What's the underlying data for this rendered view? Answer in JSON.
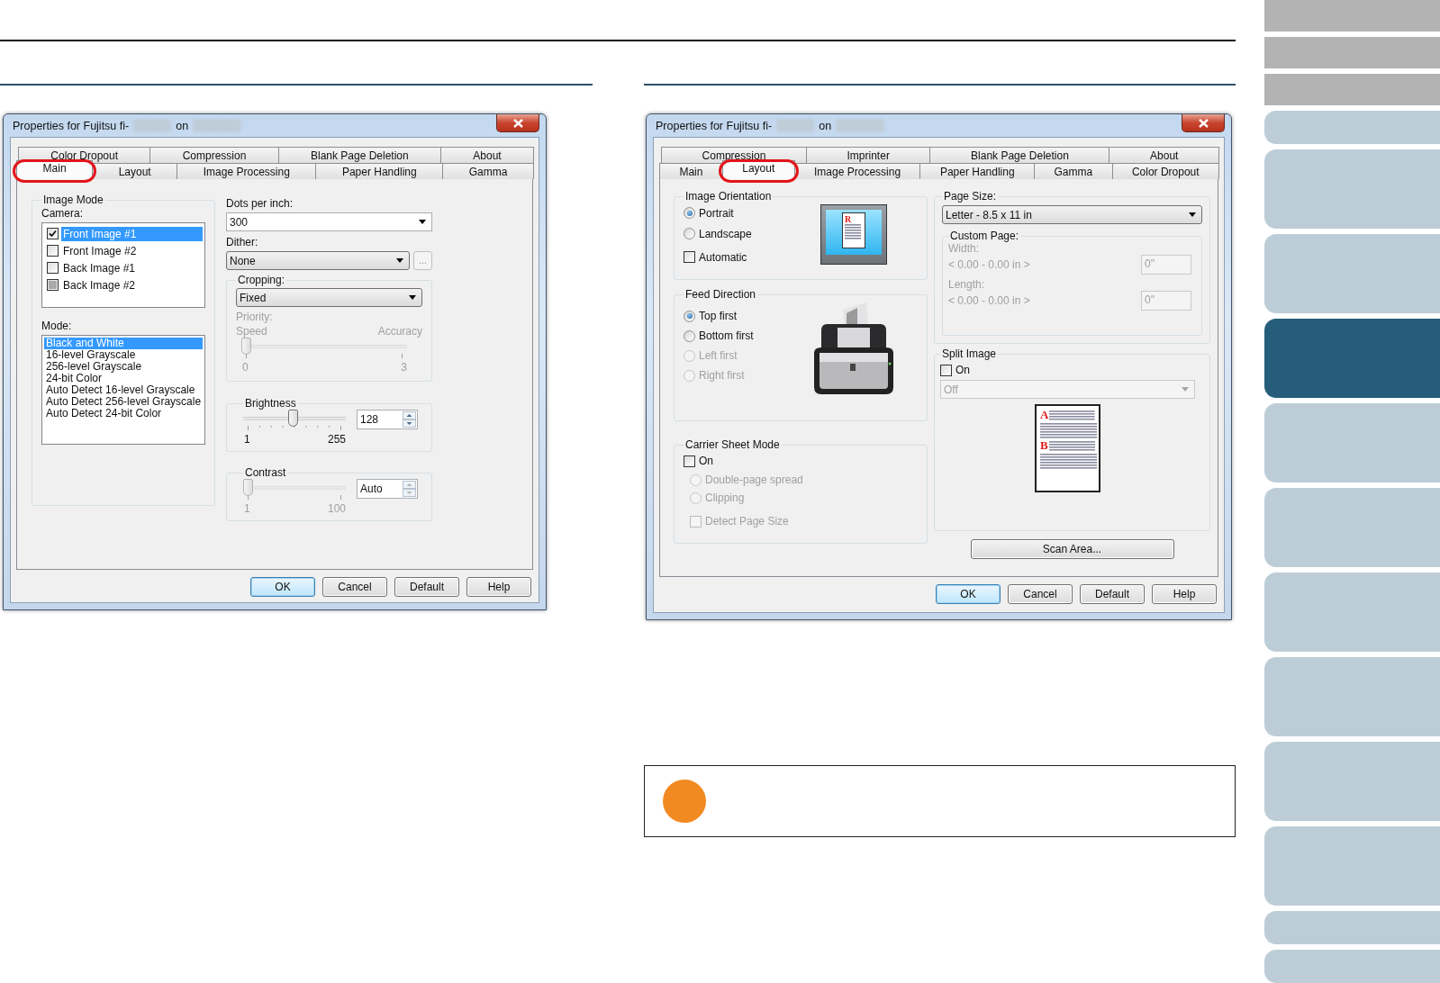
{
  "left_dialog": {
    "title": "Properties for Fujitsu fi-",
    "title_suffix": "on",
    "tab_rows": [
      [
        {
          "label": "Color Dropout",
          "selected": false,
          "highlighted": false
        },
        {
          "label": "Compression",
          "selected": false,
          "highlighted": false
        },
        {
          "label": "Blank Page Deletion",
          "selected": false,
          "highlighted": false
        },
        {
          "label": "About",
          "selected": false,
          "highlighted": false
        }
      ],
      [
        {
          "label": "Main",
          "selected": true,
          "highlighted": true
        },
        {
          "label": "Layout",
          "selected": false,
          "highlighted": false
        },
        {
          "label": "Image Processing",
          "selected": false,
          "highlighted": false
        },
        {
          "label": "Paper Handling",
          "selected": false,
          "highlighted": false
        },
        {
          "label": "Gamma",
          "selected": false,
          "highlighted": false
        }
      ]
    ],
    "image_mode": {
      "title": "Image Mode",
      "camera_label": "Camera:",
      "cameras": [
        {
          "label": "Front Image #1",
          "checked": true,
          "selected": true
        },
        {
          "label": "Front Image #2",
          "checked": false,
          "selected": false
        },
        {
          "label": "Back Image #1",
          "checked": false,
          "selected": false
        },
        {
          "label": "Back Image #2",
          "checked": false,
          "greyed": true,
          "selected": false
        }
      ],
      "mode_label": "Mode:",
      "modes": [
        {
          "label": "Black and White",
          "selected": true
        },
        {
          "label": "16-level Grayscale",
          "selected": false
        },
        {
          "label": "256-level Grayscale",
          "selected": false
        },
        {
          "label": "24-bit Color",
          "selected": false
        },
        {
          "label": "Auto Detect 16-level Grayscale",
          "selected": false
        },
        {
          "label": "Auto Detect 256-level Grayscale",
          "selected": false
        },
        {
          "label": "Auto Detect 24-bit Color",
          "selected": false
        }
      ]
    },
    "dpi": {
      "label": "Dots per inch:",
      "value": "300"
    },
    "dither": {
      "label": "Dither:",
      "value": "None",
      "more": "..."
    },
    "cropping": {
      "title": "Cropping:",
      "value": "Fixed",
      "priority_label": "Priority:",
      "min_caption": "Speed",
      "max_caption": "Accuracy",
      "level": 0,
      "min": "0",
      "max": "3",
      "disabled": true
    },
    "brightness": {
      "title": "Brightness",
      "level": 0.49,
      "value": "128",
      "min": "1",
      "max": "255",
      "disabled": false
    },
    "contrast": {
      "title": "Contrast",
      "level": 0,
      "value": "Auto",
      "min": "1",
      "max": "100",
      "disabled": true
    },
    "buttons": [
      {
        "label": "OK",
        "default": true
      },
      {
        "label": "Cancel",
        "default": false
      },
      {
        "label": "Default",
        "default": false
      },
      {
        "label": "Help",
        "default": false
      }
    ]
  },
  "right_dialog": {
    "title": "Properties for Fujitsu fi-",
    "title_suffix": "on",
    "tab_rows": [
      [
        {
          "label": "Compression",
          "selected": false,
          "highlighted": false
        },
        {
          "label": "Imprinter",
          "selected": false,
          "highlighted": false
        },
        {
          "label": "Blank Page Deletion",
          "selected": false,
          "highlighted": false
        },
        {
          "label": "About",
          "selected": false,
          "highlighted": false
        }
      ],
      [
        {
          "label": "Main",
          "selected": false,
          "highlighted": false
        },
        {
          "label": "Layout",
          "selected": true,
          "highlighted": true
        },
        {
          "label": "Image Processing",
          "selected": false,
          "highlighted": false
        },
        {
          "label": "Paper Handling",
          "selected": false,
          "highlighted": false
        },
        {
          "label": "Gamma",
          "selected": false,
          "highlighted": false
        },
        {
          "label": "Color Dropout",
          "selected": false,
          "highlighted": false
        }
      ]
    ],
    "image_orientation": {
      "title": "Image Orientation",
      "options": [
        {
          "label": "Portrait",
          "selected": true,
          "disabled": false
        },
        {
          "label": "Landscape",
          "selected": false,
          "disabled": false
        }
      ],
      "automatic": {
        "label": "Automatic",
        "checked": false,
        "disabled": false
      },
      "preview_letter": "R"
    },
    "feed_direction": {
      "title": "Feed Direction",
      "options": [
        {
          "label": "Top first",
          "selected": true,
          "disabled": false
        },
        {
          "label": "Bottom first",
          "selected": false,
          "disabled": false
        },
        {
          "label": "Left first",
          "selected": false,
          "disabled": true
        },
        {
          "label": "Right first",
          "selected": false,
          "disabled": true
        }
      ]
    },
    "carrier_sheet": {
      "title": "Carrier Sheet Mode",
      "on": {
        "label": "On",
        "checked": false,
        "disabled": false
      },
      "options": [
        {
          "label": "Double-page spread",
          "selected": false,
          "disabled": true
        },
        {
          "label": "Clipping",
          "selected": false,
          "disabled": true
        }
      ],
      "detect": {
        "label": "Detect Page Size",
        "checked": false,
        "disabled": true
      }
    },
    "page_size": {
      "title": "Page Size:",
      "value": "Letter - 8.5 x 11 in",
      "custom": {
        "title": "Custom Page:",
        "disabled": true,
        "fields": [
          {
            "label": "Width:",
            "range": "< 0.00 - 0.00 in >",
            "value": "0''"
          },
          {
            "label": "Length:",
            "range": "< 0.00 - 0.00 in >",
            "value": "0''"
          }
        ]
      }
    },
    "split_image": {
      "title": "Split Image",
      "on": {
        "label": "On",
        "checked": false,
        "disabled": false
      },
      "value": "Off",
      "disabled": true,
      "preview_letters": [
        "A",
        "B"
      ]
    },
    "scan_area": "Scan Area...",
    "buttons": [
      {
        "label": "OK",
        "default": true
      },
      {
        "label": "Cancel",
        "default": false
      },
      {
        "label": "Default",
        "default": false
      },
      {
        "label": "Help",
        "default": false
      }
    ]
  },
  "sidebar": {
    "items": [
      {
        "kind": "header",
        "selected": false
      },
      {
        "kind": "header",
        "selected": false
      },
      {
        "kind": "header",
        "selected": false
      },
      {
        "kind": "short",
        "selected": false
      },
      {
        "kind": "tall",
        "selected": false
      },
      {
        "kind": "tall",
        "selected": false
      },
      {
        "kind": "tall",
        "selected": true
      },
      {
        "kind": "tall",
        "selected": false
      },
      {
        "kind": "tall",
        "selected": false
      },
      {
        "kind": "tall",
        "selected": false
      },
      {
        "kind": "tall",
        "selected": false
      },
      {
        "kind": "tall",
        "selected": false
      },
      {
        "kind": "tall",
        "selected": false
      },
      {
        "kind": "short",
        "selected": false
      },
      {
        "kind": "short",
        "selected": false
      }
    ]
  }
}
